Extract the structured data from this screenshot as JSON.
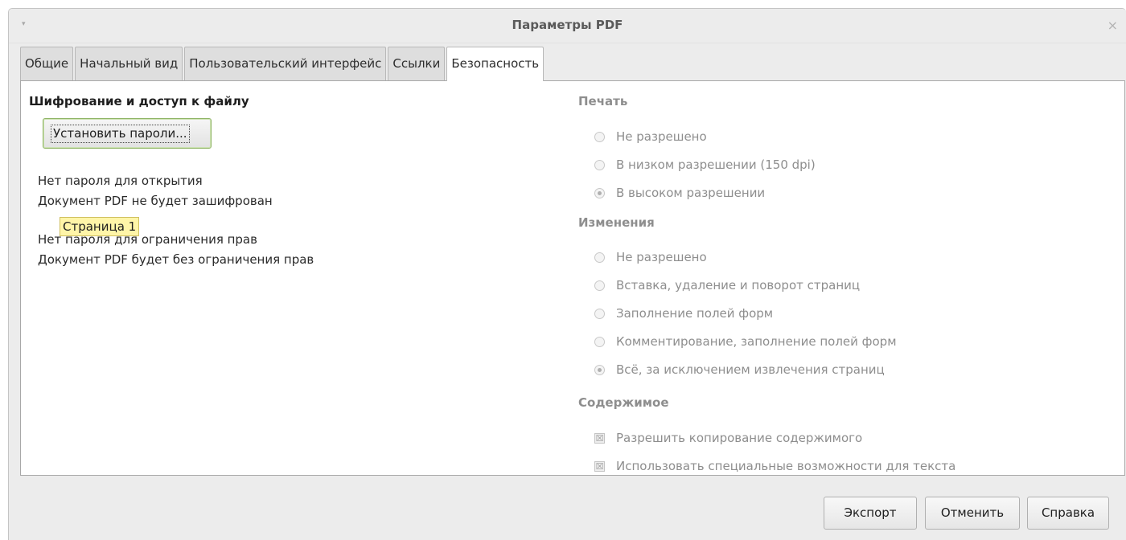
{
  "window": {
    "title": "Параметры PDF",
    "menu_icon": "▾",
    "close_icon": "×"
  },
  "tabs": [
    {
      "label": "Общие",
      "active": false
    },
    {
      "label": "Начальный вид",
      "active": false
    },
    {
      "label": "Пользовательский интерфейс",
      "active": false
    },
    {
      "label": "Ссылки",
      "active": false
    },
    {
      "label": "Безопасность",
      "active": true
    }
  ],
  "encryption": {
    "title": "Шифрование и доступ к файлу",
    "set_passwords_button": "Установить пароли...",
    "info": [
      "Нет пароля для открытия",
      "Документ PDF не будет зашифрован",
      "Нет пароля для ограничения прав",
      "Документ PDF будет без ограничения прав"
    ],
    "tooltip": "Страница 1"
  },
  "printing": {
    "title": "Печать",
    "options": [
      {
        "label": "Не разрешено",
        "selected": false
      },
      {
        "label": "В низком разрешении (150 dpi)",
        "selected": false
      },
      {
        "label": "В высоком разрешении",
        "selected": true
      }
    ]
  },
  "changes": {
    "title": "Изменения",
    "options": [
      {
        "label": "Не разрешено",
        "selected": false
      },
      {
        "label": "Вставка, удаление и поворот страниц",
        "selected": false
      },
      {
        "label": "Заполнение полей форм",
        "selected": false
      },
      {
        "label": "Комментирование, заполнение полей форм",
        "selected": false
      },
      {
        "label": "Всё, за исключением извлечения страниц",
        "selected": true
      }
    ]
  },
  "content": {
    "title": "Содержимое",
    "options": [
      {
        "label": "Разрешить копирование содержимого",
        "checked": true
      },
      {
        "label": "Использовать специальные возможности для текста",
        "checked": true
      }
    ]
  },
  "buttons": {
    "export": "Экспорт",
    "cancel": "Отменить",
    "help": "Справка"
  },
  "icons": {
    "radio": "radio-button",
    "checkbox": "checkbox",
    "check_mark": "☒"
  }
}
